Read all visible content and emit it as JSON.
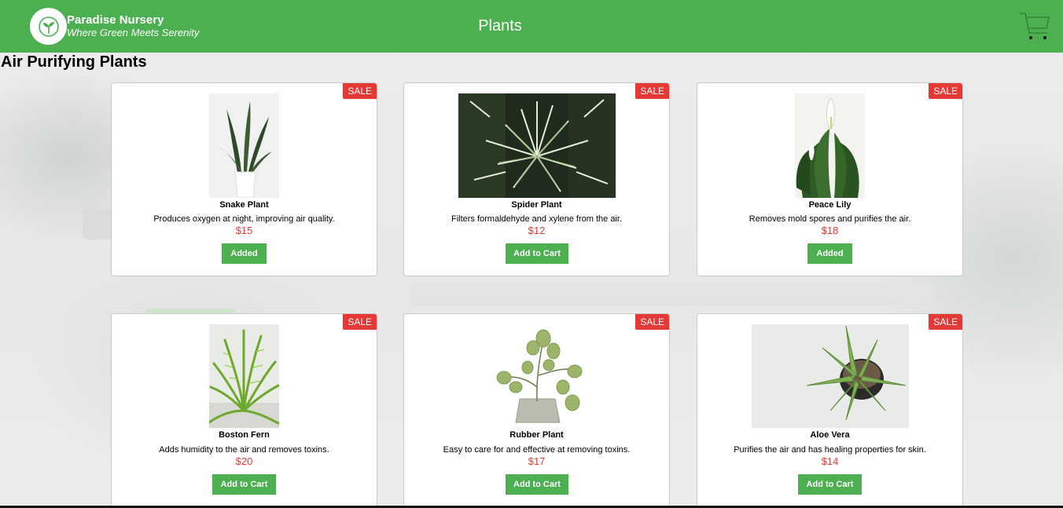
{
  "header": {
    "brand_name": "Paradise Nursery",
    "brand_tagline": "Where Green Meets Serenity",
    "nav_title": "Plants",
    "accent_color": "#4caf50"
  },
  "section": {
    "title": "Air Purifying Plants"
  },
  "plants": [
    {
      "badge": "SALE",
      "name": "Snake Plant",
      "description": "Produces oxygen at night, improving air quality.",
      "price": "$15",
      "button": "Added"
    },
    {
      "badge": "SALE",
      "name": "Spider Plant",
      "description": "Filters formaldehyde and xylene from the air.",
      "price": "$12",
      "button": "Add to Cart"
    },
    {
      "badge": "SALE",
      "name": "Peace Lily",
      "description": "Removes mold spores and purifies the air.",
      "price": "$18",
      "button": "Added"
    },
    {
      "badge": "SALE",
      "name": "Boston Fern",
      "description": "Adds humidity to the air and removes toxins.",
      "price": "$20",
      "button": "Add to Cart"
    },
    {
      "badge": "SALE",
      "name": "Rubber Plant",
      "description": "Easy to care for and effective at removing toxins.",
      "price": "$17",
      "button": "Add to Cart"
    },
    {
      "badge": "SALE",
      "name": "Aloe Vera",
      "description": "Purifies the air and has healing properties for skin.",
      "price": "$14",
      "button": "Add to Cart"
    }
  ],
  "icons": {
    "logo": "sprout-icon",
    "cart": "shopping-cart-icon"
  },
  "colors": {
    "sale_badge": "#e53935",
    "price": "#e53935",
    "button": "#4caf50"
  }
}
